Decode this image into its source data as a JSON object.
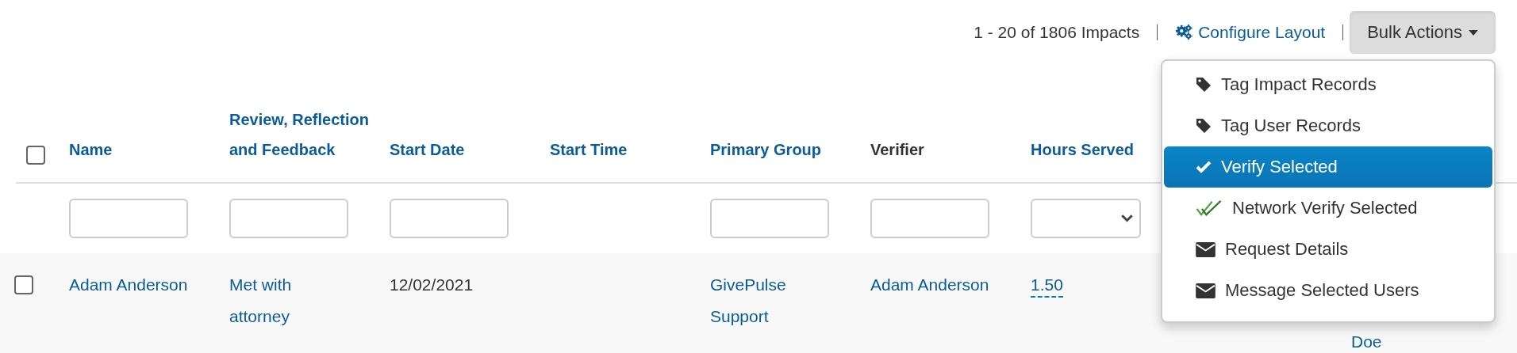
{
  "toolbar": {
    "count": "1 - 20 of 1806 Impacts",
    "configure_link": "Configure Layout",
    "bulk_button": {
      "label": "Bulk Actions",
      "expanded": true
    }
  },
  "table": {
    "select_all": {
      "checked": false
    },
    "columns": [
      {
        "label": "Name",
        "sortable": true,
        "kind": "text"
      },
      {
        "label": "Review, Reflection and Feedback",
        "sortable": true,
        "kind": "text"
      },
      {
        "label": "Start Date",
        "sortable": true,
        "kind": "text"
      },
      {
        "label": "Start Time",
        "sortable": true,
        "kind": "none"
      },
      {
        "label": "Primary Group",
        "sortable": true,
        "kind": "text"
      },
      {
        "label": "Verifier",
        "sortable": false,
        "kind": "text"
      },
      {
        "label": "Hours Served",
        "sortable": true,
        "kind": "select"
      }
    ],
    "rows": [
      {
        "checked": false,
        "name": "Adam Anderson",
        "review": "Met with attorney",
        "start_date": "12/02/2021",
        "primary_group": "GivePulse Support",
        "verifier": "Adam Anderson",
        "hours_served": "1.50",
        "column_9": "Doe"
      }
    ]
  },
  "bulk_menu": {
    "items": [
      {
        "label": "Tag Impact Records",
        "kind": "tag",
        "selected": false
      },
      {
        "label": "Tag User Records",
        "kind": "tag",
        "selected": false
      },
      {
        "label": "Verify Selected",
        "kind": "check",
        "selected": true
      },
      {
        "label": "Network Verify Selected",
        "kind": "double-check",
        "selected": false
      },
      {
        "label": "Request Details",
        "kind": "envelope",
        "selected": false
      },
      {
        "label": "Message Selected Users",
        "kind": "envelope",
        "selected": false
      }
    ]
  }
}
